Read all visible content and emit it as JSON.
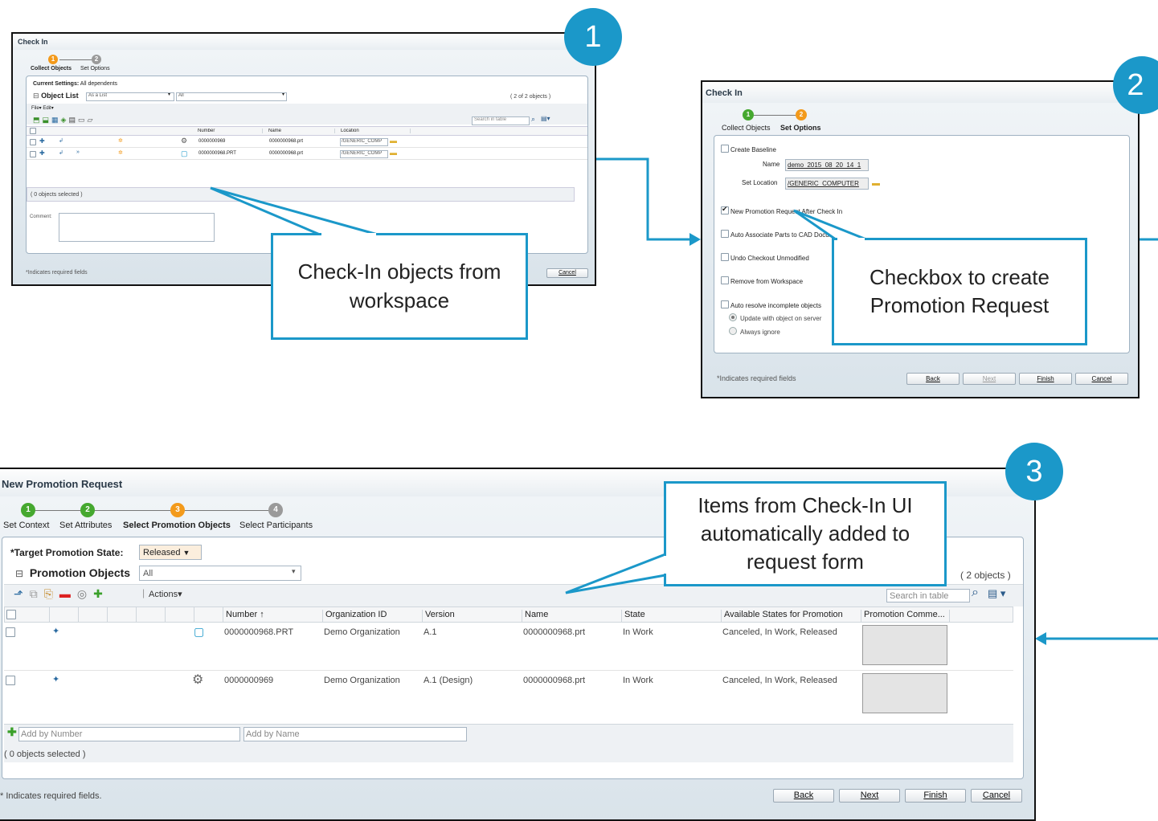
{
  "colors": {
    "accent": "#1b98c9",
    "step_done": "#45a82f",
    "step_current": "#f39a1b",
    "step_todo": "#9a9a9a"
  },
  "badges": [
    "1",
    "2",
    "3"
  ],
  "callouts": {
    "c1": "Check-In objects from workspace",
    "c2": "Checkbox to create Promotion Request",
    "c3": "Items from Check-In UI automatically added to request form"
  },
  "win1": {
    "title": "Check In",
    "steps": [
      {
        "label": "Collect Objects",
        "n": "1"
      },
      {
        "label": "Set Options",
        "n": "2"
      }
    ],
    "current_settings_label": "Current Settings:",
    "current_settings_value": "All dependents",
    "object_list_label": "Object List",
    "view_select": "As a List",
    "filter_select": "All",
    "count": "( 2 of 2 objects )",
    "menu_file": "File",
    "menu_edit": "Edit",
    "search_placeholder": "Search in table",
    "columns": [
      "Number",
      "Name",
      "Location"
    ],
    "rows": [
      {
        "number": "0000000969",
        "name": "0000000968.prt",
        "location": "/GENERIC_COMP"
      },
      {
        "number": "0000000968.PRT",
        "name": "0000000968.prt",
        "location": "/GENERIC_COMP"
      }
    ],
    "selected": "( 0 objects selected )",
    "comment_label": "Comment:",
    "required_note": "*Indicates required fields",
    "cancel": "Cancel"
  },
  "win2": {
    "title": "Check In",
    "steps": [
      {
        "label": "Collect Objects",
        "n": "1"
      },
      {
        "label": "Set Options",
        "n": "2"
      }
    ],
    "create_baseline": "Create Baseline",
    "name_label": "Name",
    "name_value": "demo_2015_08_20_14_1",
    "set_location_label": "Set Location",
    "set_location_value": "/GENERIC_COMPUTER",
    "opt_new_promotion": "New Promotion Request After Check In",
    "opt_auto_associate": "Auto Associate Parts to CAD Documents",
    "opt_undo_checkout": "Undo Checkout Unmodified",
    "opt_remove": "Remove from Workspace",
    "opt_auto_resolve": "Auto resolve incomplete objects",
    "radio_update": "Update with object on server",
    "radio_ignore": "Always ignore",
    "required_note": "*Indicates required fields",
    "back": "Back",
    "next": "Next",
    "finish": "Finish",
    "cancel": "Cancel"
  },
  "win3": {
    "title": "New Promotion Request",
    "steps": [
      {
        "label": "Set Context",
        "n": "1"
      },
      {
        "label": "Set Attributes",
        "n": "2"
      },
      {
        "label": "Select Promotion Objects",
        "n": "3"
      },
      {
        "label": "Select Participants",
        "n": "4"
      }
    ],
    "target_state_label": "*Target Promotion State:",
    "target_state_value": "Released",
    "promotion_objects_label": "Promotion Objects",
    "filter_select": "All",
    "count": "( 2 objects )",
    "actions": "Actions",
    "search_placeholder": "Search in table",
    "columns": [
      "Number",
      "Organization ID",
      "Version",
      "Name",
      "State",
      "Available States for Promotion",
      "Promotion Comme..."
    ],
    "rows": [
      {
        "number": "0000000968.PRT",
        "org": "Demo Organization",
        "version": "A.1",
        "name": "0000000968.prt",
        "state": "In Work",
        "avail": "Canceled, In Work, Released"
      },
      {
        "number": "0000000969",
        "org": "Demo Organization",
        "version": "A.1 (Design)",
        "name": "0000000968.prt",
        "state": "In Work",
        "avail": "Canceled, In Work, Released"
      }
    ],
    "add_by_number": "Add by Number",
    "add_by_name": "Add by Name",
    "selected": "( 0 objects selected )",
    "required_note": "* Indicates required fields.",
    "back": "Back",
    "next": "Next",
    "finish": "Finish",
    "cancel": "Cancel"
  }
}
